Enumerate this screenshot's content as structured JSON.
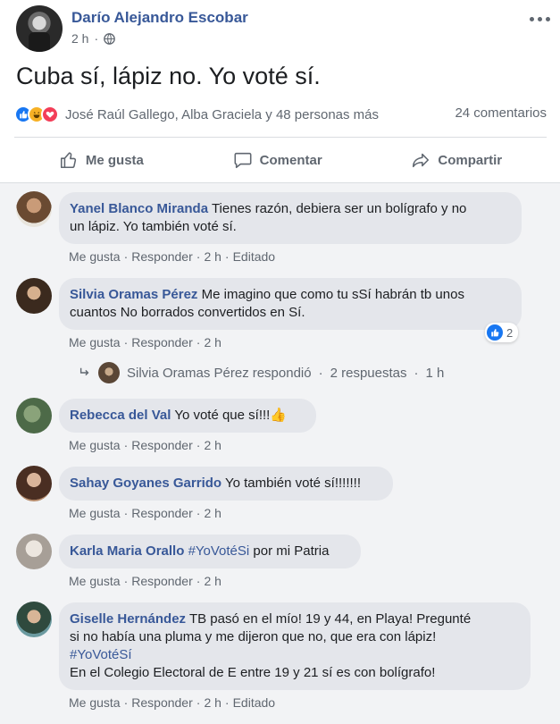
{
  "post": {
    "author": "Darío Alejandro Escobar",
    "time": "2 h",
    "text": "Cuba sí, lápiz no. Yo voté sí.",
    "reactions_text": "José Raúl Gallego, Alba Graciela y 48 personas más",
    "comment_count": "24 comentarios",
    "actions": {
      "like": "Me gusta",
      "comment": "Comentar",
      "share": "Compartir"
    }
  },
  "colors": {
    "name_blue": "#385898",
    "like_blue": "#1877f2",
    "comments_bg": "#f2f3f5"
  },
  "comments": [
    {
      "name": "Yanel Blanco Miranda",
      "text_line1": "Tienes razón, debiera ser un bolígrafo y no",
      "text_line2": "un lápiz. Yo también voté sí.",
      "like": "Me gusta",
      "reply": "Responder",
      "time": "2 h",
      "edited": "Editado"
    },
    {
      "name": "Silvia Oramas Pérez",
      "text_line1": "Me imagino que como tu sSí habrán tb unos",
      "text_line2": "cuantos No borrados convertidos en Sí.",
      "like": "Me gusta",
      "reply": "Responder",
      "time": "2 h",
      "like_count": "2",
      "replies_summary": {
        "name": "Silvia Oramas Pérez",
        "action": "respondió",
        "count": "2 respuestas",
        "time": "1 h"
      }
    },
    {
      "name": "Rebecca del Val",
      "text_line1": "Yo voté que sí!!!",
      "emoji": "👍",
      "like": "Me gusta",
      "reply": "Responder",
      "time": "2 h"
    },
    {
      "name": "Sahay Goyanes Garrido",
      "text_line1": "Yo también voté sí!!!!!!!",
      "like": "Me gusta",
      "reply": "Responder",
      "time": "2 h"
    },
    {
      "name": "Karla Maria Orallo",
      "hashtag": "#YoVotéSi",
      "text_line1": "por mi Patria",
      "like": "Me gusta",
      "reply": "Responder",
      "time": "2 h"
    },
    {
      "name": "Giselle Hernández",
      "text_line1": "TB pasó en el mío! 19 y 44, en Playa! Pregunté",
      "text_line2": "si no había una pluma y me dijeron que no, que era con lápiz!",
      "hashtag": "#YoVotéSí",
      "text_line4": "En el Colegio Electoral de E entre 19 y 21 sí es con bolígrafo!",
      "like": "Me gusta",
      "reply": "Responder",
      "time": "2 h",
      "edited": "Editado"
    }
  ]
}
